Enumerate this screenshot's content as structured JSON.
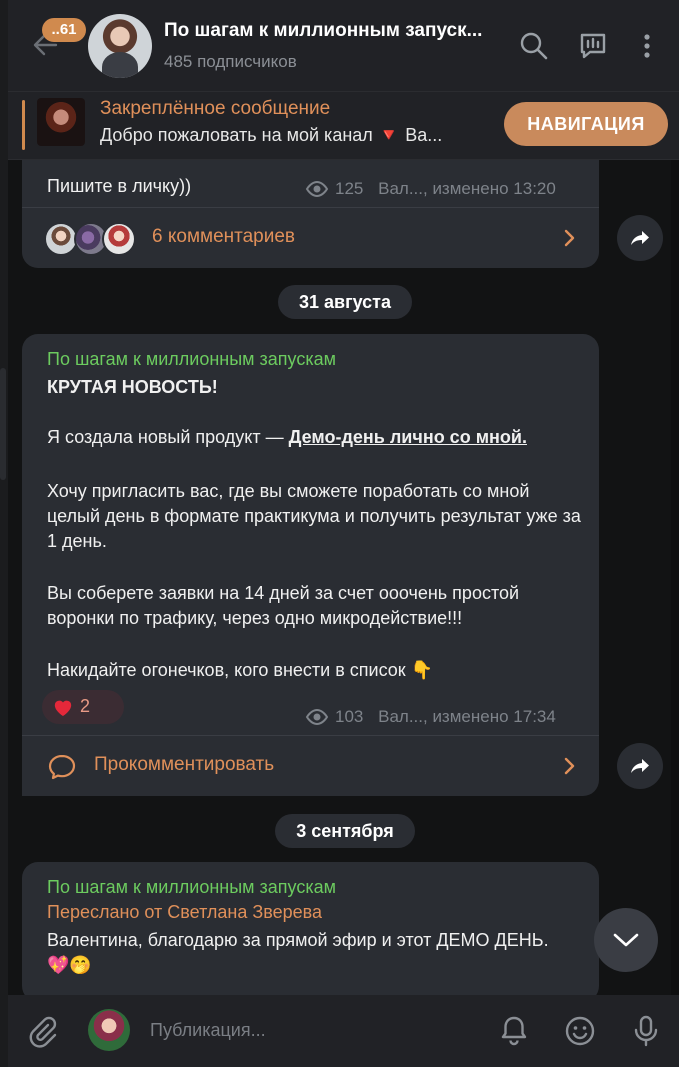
{
  "header": {
    "unread_count": "..61",
    "title": "По шагам к миллионным запуск...",
    "subscribers": "485 подписчиков"
  },
  "icons": {
    "back": "back-arrow-icon",
    "search": "search-icon",
    "chat": "chat-icon",
    "more": "more-vertical-icon",
    "eye": "eye-icon",
    "chevron": "chevron-right-icon",
    "share": "share-icon",
    "comment": "comment-icon",
    "heart": "heart-icon",
    "scroll_down": "chevron-down-icon",
    "attach": "paperclip-icon",
    "bell": "bell-icon",
    "smile": "smile-icon",
    "mic": "microphone-icon"
  },
  "colors": {
    "accent": "#d08a4e",
    "sender": "#6ccb5f",
    "bubble": "#2a2d33",
    "background": "#121314"
  },
  "pinned": {
    "title": "Закреплённое сообщение",
    "text": "Добро пожаловать на мой канал 🔻 Ва...",
    "button": "НАВИГАЦИЯ"
  },
  "messages": [
    {
      "text": "Пишите в личку))",
      "views": "125",
      "meta": "Вал..., изменено 13:20",
      "comments_label": "6 комментариев"
    },
    {
      "date": "31 августа",
      "sender": "По шагам к миллионным запускам",
      "headline": "КРУТАЯ НОВОСТЬ!",
      "p1_prefix": "Я создала новый продукт — ",
      "p1_link": "Демо-день лично со мной.",
      "p2": "Хочу пригласить вас, где вы сможете поработать со мной целый день в формате практикума и получить результат уже за 1 день.",
      "p3": "Вы соберете заявки на 14 дней за счет ооочень простой воронки по трафику, через одно микродействие!!!",
      "p4": "Накидайте огонечков, кого внести в список 👇",
      "reaction_count": "2",
      "views": "103",
      "meta": "Вал..., изменено 17:34",
      "comments_label": "Прокомментировать"
    },
    {
      "date": "3 сентября",
      "sender": "По шагам к миллионным запускам",
      "forwarded": "Переслано от Светлана Зверева",
      "text": "Валентина, благодарю за прямой эфир и этот ДЕМО ДЕНЬ. 💖🤭"
    }
  ],
  "composer": {
    "placeholder": "Публикация..."
  }
}
